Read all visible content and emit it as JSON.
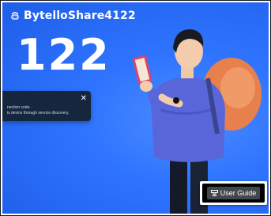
{
  "app": {
    "name": "BytelloShare4122",
    "connection_code": "122"
  },
  "tooltip": {
    "line1": "nection code.",
    "line2": "is device through service discovery.",
    "close_glyph": "✕"
  },
  "actions": {
    "user_guide_label": "User Guide",
    "user_guide_icon": "guide-icon"
  },
  "colors": {
    "background": "#2f74ff",
    "text": "#ffffff",
    "tooltip_bg": "#15263f"
  }
}
